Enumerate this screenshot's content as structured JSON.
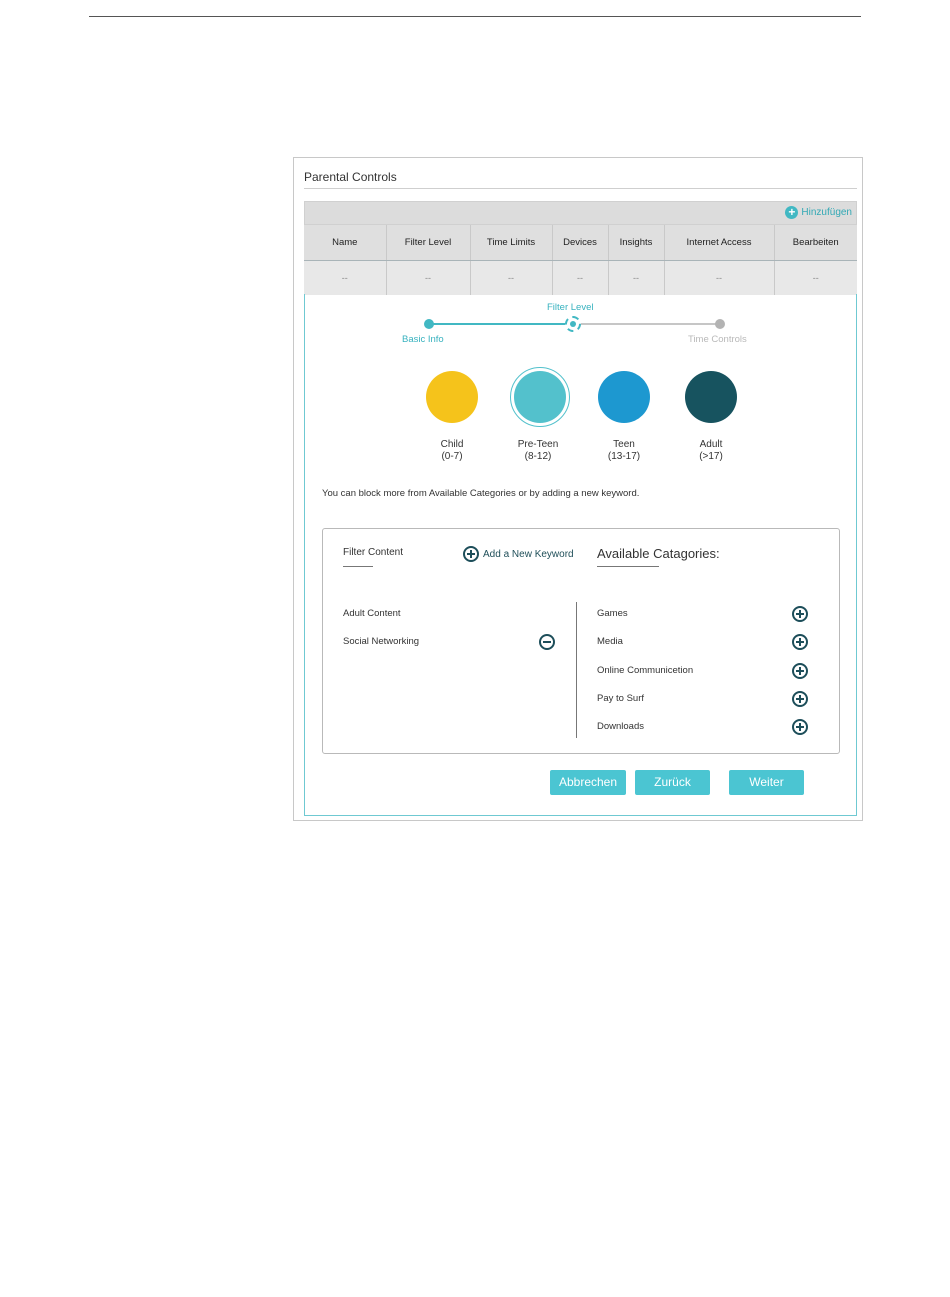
{
  "panel": {
    "title": "Parental Controls"
  },
  "toolbar": {
    "add_label": "Hinzufügen"
  },
  "table": {
    "columns": [
      "Name",
      "Filter Level",
      "Time Limits",
      "Devices",
      "Insights",
      "Internet Access",
      "Bearbeiten"
    ],
    "rows": [
      [
        "--",
        "--",
        "--",
        "--",
        "--",
        "--",
        "--"
      ]
    ]
  },
  "wizard": {
    "steps": [
      {
        "label": "Basic Info",
        "state": "done"
      },
      {
        "label": "Filter Level",
        "state": "current"
      },
      {
        "label": "Time Controls",
        "state": "pending"
      }
    ],
    "levels": [
      {
        "name": "Child",
        "range": "(0-7)",
        "color": "#f5c31b",
        "selected": false
      },
      {
        "name": "Pre-Teen",
        "range": "(8-12)",
        "color": "#53c1cc",
        "selected": true
      },
      {
        "name": "Teen",
        "range": "(13-17)",
        "color": "#1d98d0",
        "selected": false
      },
      {
        "name": "Adult",
        "range": "(>17)",
        "color": "#17535f",
        "selected": false
      }
    ],
    "hint": "You can block more from Available Categories or by adding a new keyword."
  },
  "filter": {
    "title": "Filter Content",
    "add_keyword": "Add a New Keyword",
    "available_title": "Available Catagories:",
    "blocked": [
      "Adult Content",
      "Social Networking"
    ],
    "available": [
      "Games",
      "Media",
      "Online Communicetion",
      "Pay to Surf",
      "Downloads"
    ]
  },
  "buttons": {
    "cancel": "Abbrechen",
    "back": "Zurück",
    "next": "Weiter"
  },
  "colors": {
    "accent": "#4bc5d2",
    "icon_dark": "#1d4e5a"
  }
}
